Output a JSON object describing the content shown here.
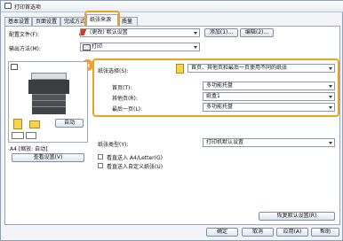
{
  "window": {
    "title": "打印首选项"
  },
  "tabs": [
    {
      "label": "基本设置"
    },
    {
      "label": "页面设置"
    },
    {
      "label": "完成方式"
    },
    {
      "label": "纸张来源"
    },
    {
      "label": "质量"
    }
  ],
  "profile": {
    "label": "配置文件(F):",
    "value": "(更改) 默认设置",
    "add_button": "添加(1)...",
    "edit_button": "编辑(2)..."
  },
  "output": {
    "label": "输出方法(M):",
    "value": "打印"
  },
  "paper_selection": {
    "badge": "a",
    "label": "纸张选择(S):",
    "value": "首页、其他页和最后一页使用不同的纸张",
    "first_page": {
      "label": "首页(T):",
      "value": "多功能托盘"
    },
    "other_pages": {
      "label": "其他页(R):",
      "value": "纸盒1"
    },
    "last_page": {
      "label": "最后一页(L):",
      "value": "多功能托盘"
    }
  },
  "paper_type": {
    "label": "纸张类型(Y):",
    "value": "打印机默认设置"
  },
  "checkboxes": [
    {
      "label": "看直送入 A4/Letter(G)",
      "checked": false
    },
    {
      "label": "看直送入自定义纸张(U)",
      "checked": false
    }
  ],
  "preview": {
    "auto_button": "自动",
    "caption": "A4 [缩放: 自动]",
    "view_settings_button": "查看设置(V)"
  },
  "restore_defaults_button": "恢复默认设置(R)",
  "footer": {
    "ok": "确定",
    "cancel": "取消",
    "apply": "应用(A)",
    "help": "帮助"
  },
  "colors": {
    "accent": "#f0a020"
  }
}
